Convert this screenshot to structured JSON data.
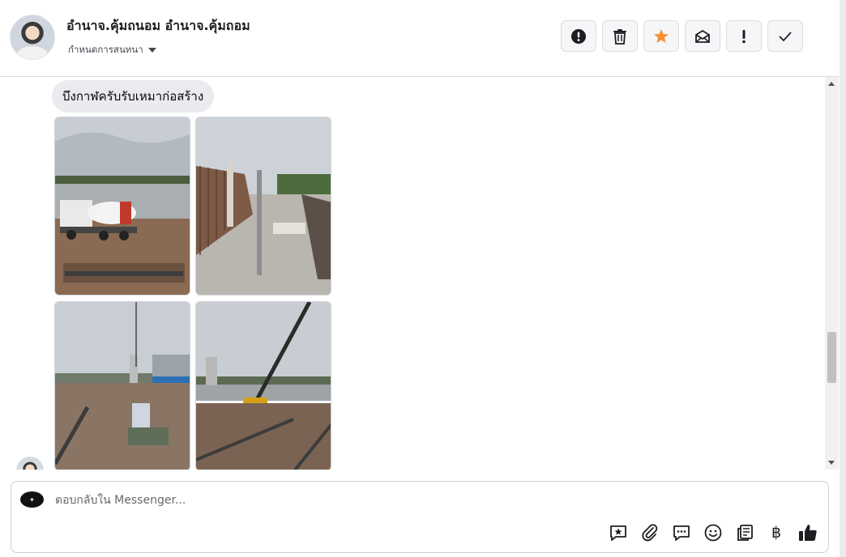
{
  "header": {
    "contact_name": "อำนาจ.คุ้มถนอม อำนาจ.คุ้มถอม",
    "assign_label": "กำหนดการสนทนา",
    "actions": [
      {
        "name": "report-spam-button",
        "icon": "alert-circle-icon"
      },
      {
        "name": "delete-button",
        "icon": "trash-icon"
      },
      {
        "name": "star-button",
        "icon": "star-icon",
        "color": "#f7923a"
      },
      {
        "name": "mark-unread-button",
        "icon": "envelope-icon"
      },
      {
        "name": "important-button",
        "icon": "exclamation-icon"
      },
      {
        "name": "done-button",
        "icon": "check-icon"
      }
    ]
  },
  "thread": {
    "message_text": "บึงกาฬครับรับเหมาก่อสร้าง",
    "photos": [
      {
        "name": "photo-concrete-truck",
        "icon": "construction-photo"
      },
      {
        "name": "photo-rebar-wall",
        "icon": "construction-photo"
      },
      {
        "name": "photo-site-equipment",
        "icon": "construction-photo"
      },
      {
        "name": "photo-crane",
        "icon": "construction-photo"
      }
    ]
  },
  "composer": {
    "placeholder": "ตอบกลับใน Messenger...",
    "tools": [
      "saved-reply-icon",
      "attachment-icon",
      "chat-bubble-icon",
      "emoji-icon",
      "catalog-icon",
      "baht-icon",
      "thumbs-up-icon"
    ],
    "baht_symbol": "฿"
  },
  "colors": {
    "accent_star": "#f7923a",
    "bubble_bg": "#e9ebee"
  }
}
